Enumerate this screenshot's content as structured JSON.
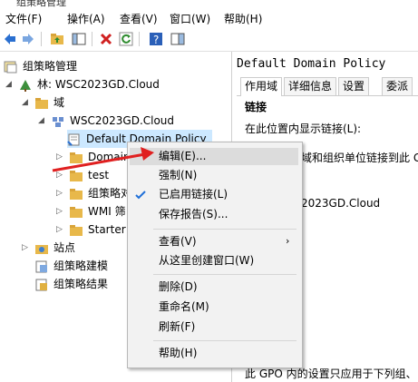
{
  "window": {
    "title": "组策略管理"
  },
  "menu": [
    "文件(F)",
    "操作(A)",
    "查看(V)",
    "窗口(W)",
    "帮助(H)"
  ],
  "tree": {
    "root": "组策略管理",
    "forest": "林: WSC2023GD.Cloud",
    "domains": "域",
    "domain": "WSC2023GD.Cloud",
    "gpo": "Default Domain Policy",
    "domain_ctrl": "Domain",
    "test": "test",
    "gpo_objects": "组策略对",
    "wmi": "WMI 筛",
    "starter": "Starter",
    "sites": "站点",
    "modeling": "组策略建模",
    "results": "组策略结果"
  },
  "right": {
    "title": "Default Domain Policy",
    "tabs": [
      "作用域",
      "详细信息",
      "设置",
      "委派"
    ],
    "section": "链接",
    "location_label": "在此位置内显示链接(L):",
    "linked_text": "域和组织单位链接到此 G",
    "domain_value": "2023GD.Cloud",
    "footer": "此 GPO 内的设置只应用于下列组、"
  },
  "context_menu": {
    "items": [
      "编辑(E)...",
      "强制(N)",
      "已启用链接(L)",
      "保存报告(S)...",
      "查看(V)",
      "从这里创建窗口(W)",
      "删除(D)",
      "重命名(M)",
      "刷新(F)",
      "帮助(H)"
    ]
  },
  "colors": {
    "selection": "#cce8ff",
    "arrow": "#e02020",
    "menu_bg": "#f2f2f2",
    "check": "#1e6fd8"
  }
}
